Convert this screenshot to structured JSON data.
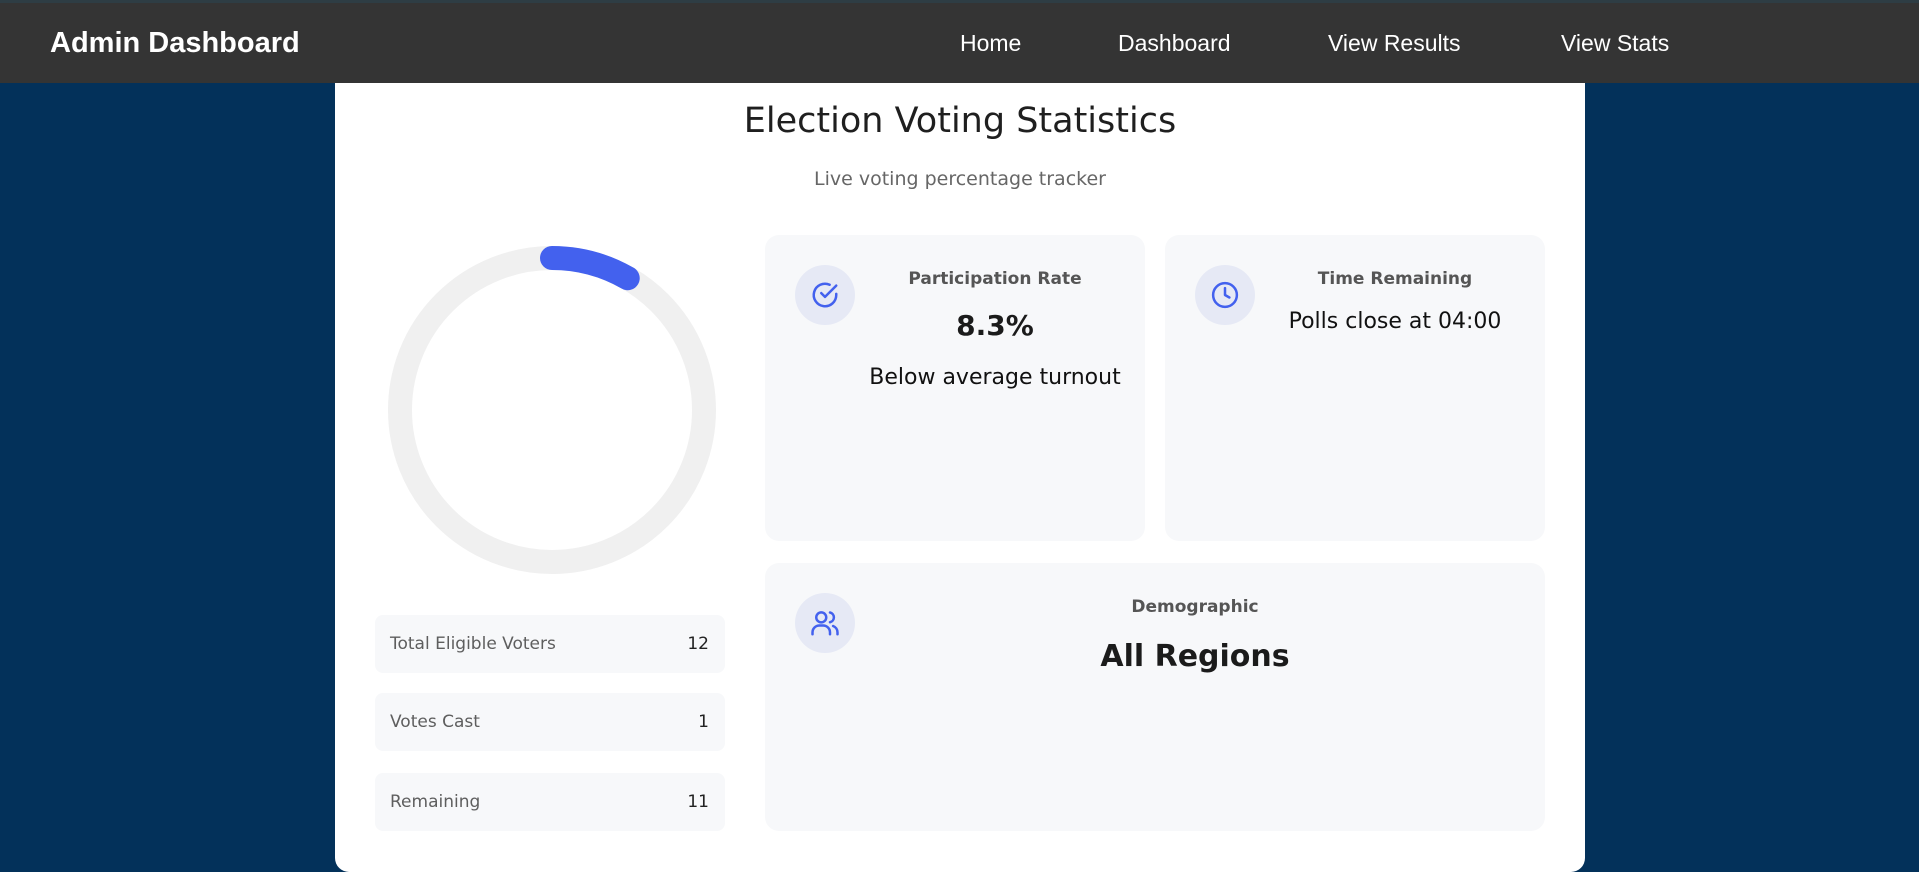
{
  "navbar": {
    "brand": "Admin Dashboard",
    "links": [
      "Home",
      "Dashboard",
      "View Results",
      "View Stats"
    ]
  },
  "header": {
    "title": "Election Voting Statistics",
    "subtitle": "Live voting percentage tracker"
  },
  "gauge": {
    "fraction": 0.083,
    "track_color": "#f0f0f0",
    "fill_color": "#4361ee"
  },
  "stats": [
    {
      "label": "Total Eligible Voters",
      "value": "12"
    },
    {
      "label": "Votes Cast",
      "value": "1"
    },
    {
      "label": "Remaining",
      "value": "11"
    }
  ],
  "cards": {
    "participation": {
      "icon": "check-circle-icon",
      "label": "Participation Rate",
      "value": "8.3%",
      "note": "Below average turnout"
    },
    "time": {
      "icon": "clock-icon",
      "label": "Time Remaining",
      "note": "Polls close at 04:00"
    },
    "demographic": {
      "icon": "users-icon",
      "label": "Demographic",
      "value": "All Regions"
    }
  },
  "colors": {
    "page_background": "#03315a",
    "navbar": "#343434",
    "accent": "#4361ee"
  }
}
